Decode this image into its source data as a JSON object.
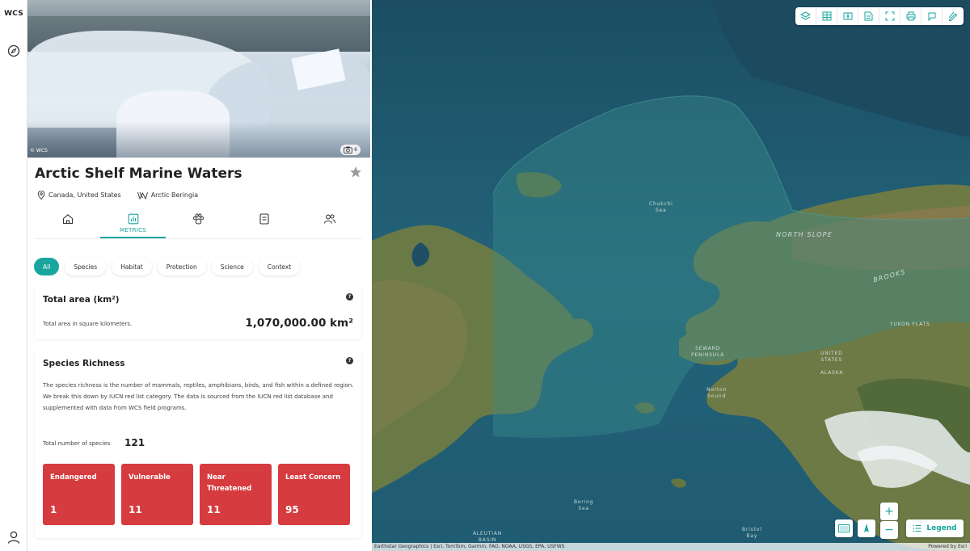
{
  "rail": {
    "logo": "WCS"
  },
  "hero": {
    "credit": "© WCS",
    "photo_count": "6"
  },
  "place": {
    "title": "Arctic Shelf Marine Waters",
    "location": "Canada, United States",
    "region": "Arctic Beringia"
  },
  "tabs": [
    {
      "icon": "home-icon",
      "label": ""
    },
    {
      "icon": "chart-icon",
      "label": "METRICS",
      "active": true
    },
    {
      "icon": "paw-icon",
      "label": ""
    },
    {
      "icon": "document-icon",
      "label": ""
    },
    {
      "icon": "people-icon",
      "label": ""
    }
  ],
  "filters": [
    "All",
    "Species",
    "Habitat",
    "Protection",
    "Science",
    "Context"
  ],
  "total_area": {
    "title": "Total area (km²)",
    "description": "Total area in square kilometers.",
    "value": "1,070,000.00 km²"
  },
  "species_richness": {
    "title": "Species Richness",
    "description": "The species richness is the number of mammals, reptiles, amphibians, birds, and fish within a defined region. We break this down by IUCN red list category. The data is sourced from the IUCN red list database and supplemented with data from WCS field programs.",
    "total_label": "Total number of species",
    "total_value": "121",
    "categories": [
      {
        "name": "Endangered",
        "value": "1"
      },
      {
        "name": "Vulnerable",
        "value": "11"
      },
      {
        "name": "Near Threatened",
        "value": "11"
      },
      {
        "name": "Least Concern",
        "value": "95"
      }
    ],
    "card_color": "#d63b3f"
  },
  "map": {
    "labels": {
      "chukchi": "Chukchi\nSea",
      "north_slope": "NORTH SLOPE",
      "brooks": "BROOKS",
      "yukon_flats": "YUKON FLATS",
      "seward": "SEWARD\nPENINSULA",
      "us": "UNITED\nSTATES",
      "alaska": "ALASKA",
      "norton": "Norton\nSound",
      "bering": "Bering\nSea",
      "aleutian": "ALEUTIAN\nBASIN",
      "bristol": "Bristol\nBay"
    },
    "toolbar": [
      "layers-icon",
      "grid-icon",
      "compare-icon",
      "report-icon",
      "fullscreen-icon",
      "print-icon",
      "share-icon",
      "draw-icon"
    ],
    "legend_label": "Legend",
    "attribution": "Earthstar Geographics | Esri, TomTom, Garmin, FAO, NOAA, USGS, EPA, USFWS",
    "powered_by": "Powered by Esri"
  },
  "accent_color": "#18a59e"
}
